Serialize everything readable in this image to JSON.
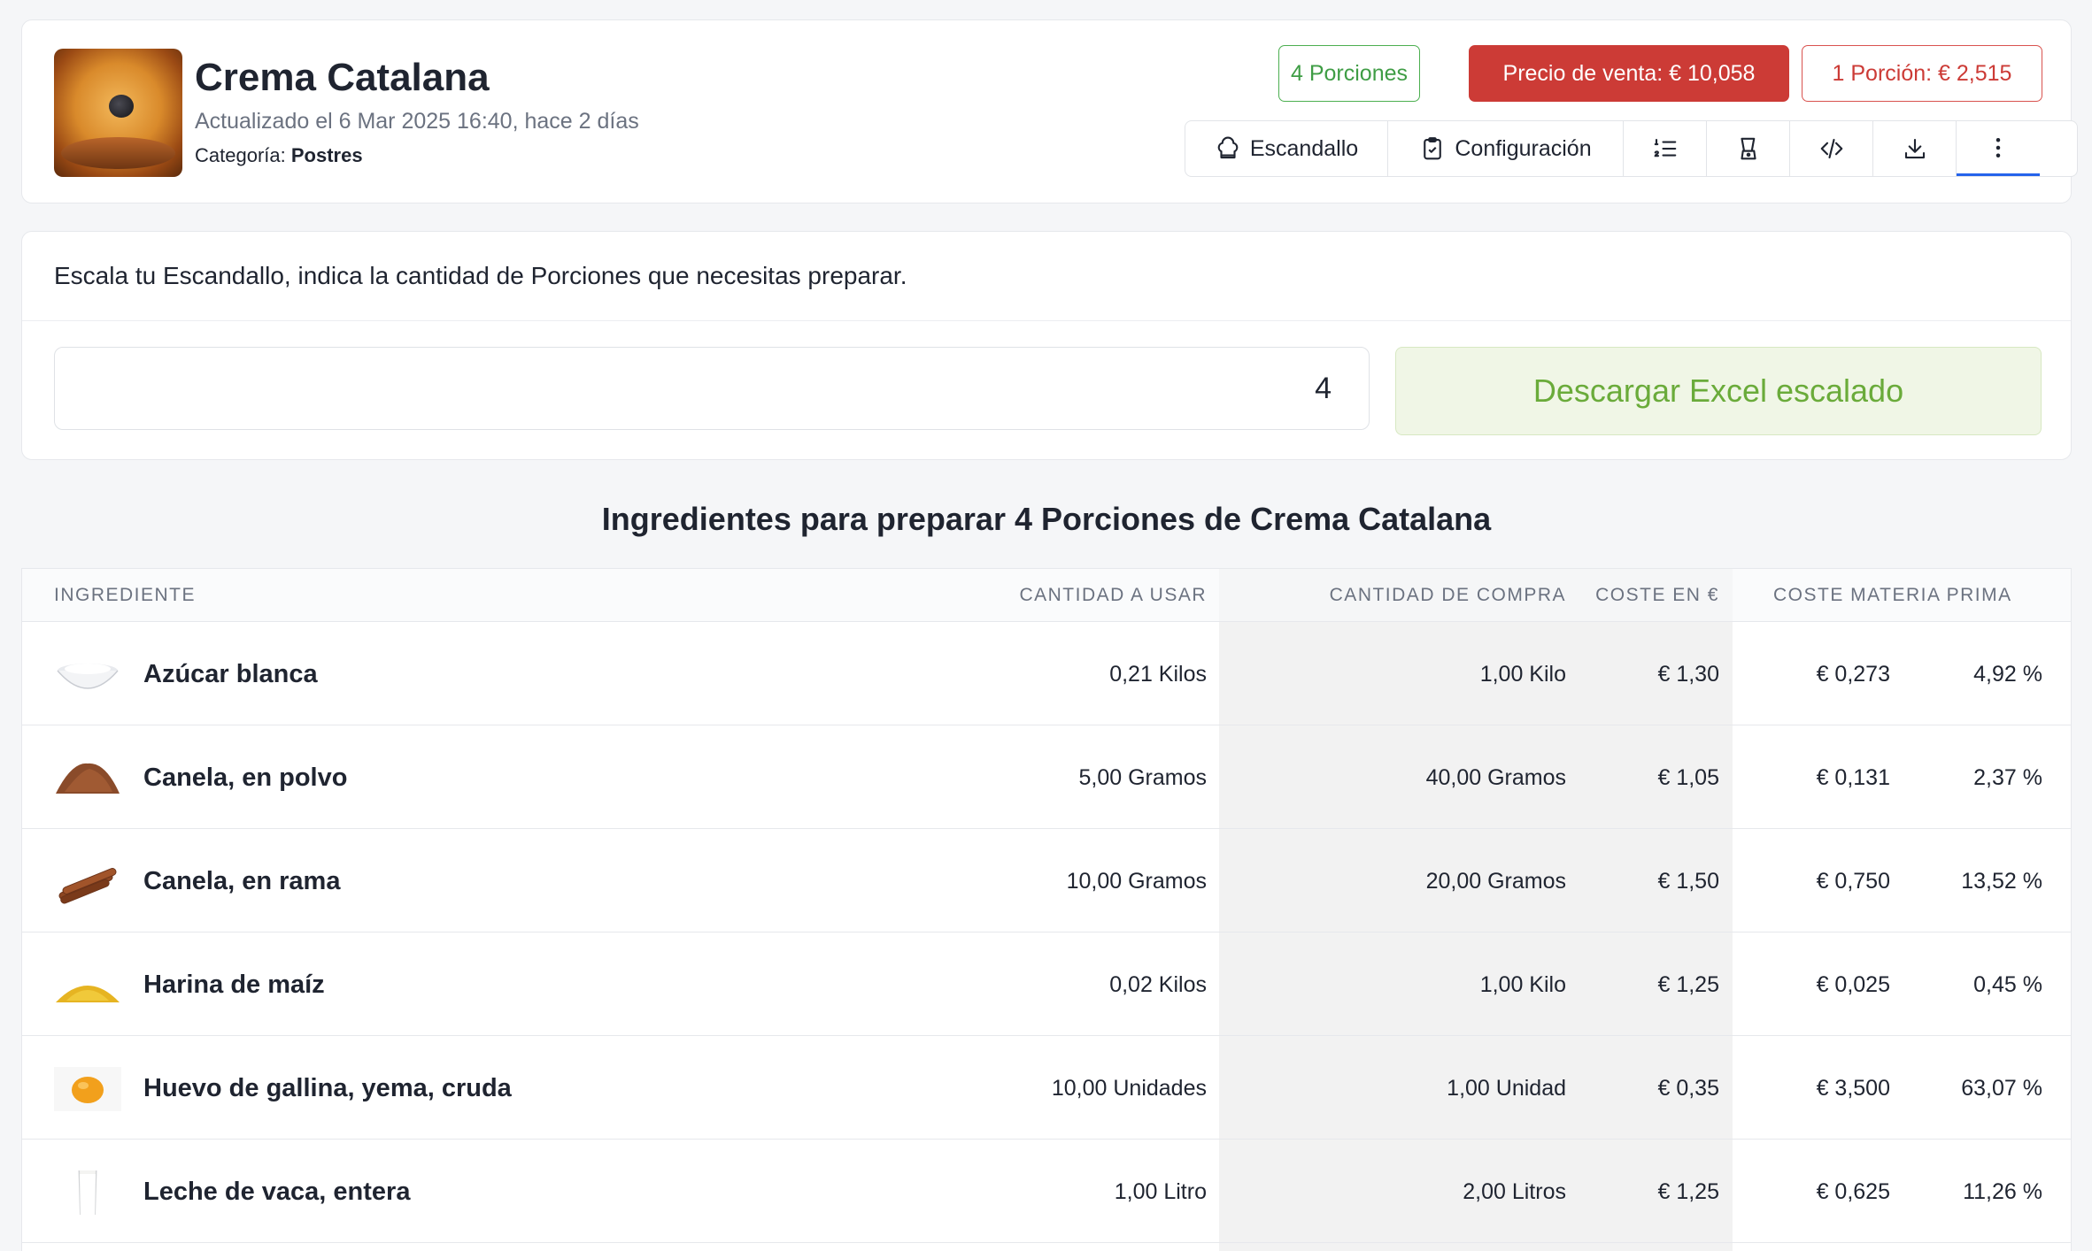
{
  "recipe": {
    "title": "Crema Catalana",
    "updated": "Actualizado el 6 Mar 2025 16:40, hace 2 días",
    "category_label": "Categoría:",
    "category_value": "Postres"
  },
  "badges": {
    "portions": "4 Porciones",
    "sale_price": "Precio de venta: € 10,058",
    "portion_cost": "1 Porción: € 2,515"
  },
  "toolbar": {
    "escandallo": "Escandallo",
    "configuracion": "Configuración"
  },
  "scale": {
    "description": "Escala tu Escandallo, indica la cantidad de Porciones que necesitas preparar.",
    "portions_value": "4",
    "download_button": "Descargar Excel escalado"
  },
  "table": {
    "title": "Ingredientes para preparar 4 Porciones de Crema Catalana",
    "headers": {
      "ingredient": "Ingrediente",
      "quantity_use": "Cantidad a usar",
      "quantity_buy": "Cantidad de compra",
      "cost": "Coste en €",
      "raw_cost": "Coste materia prima"
    },
    "rows": [
      {
        "icon": "sugar-bowl-icon",
        "name": "Azúcar blanca",
        "use": "0,21 Kilos",
        "buy": "1,00 Kilo",
        "cost": "€ 1,30",
        "raw": "€ 0,273",
        "pct": "4,92 %"
      },
      {
        "icon": "cinnamon-powder-icon",
        "name": "Canela, en polvo",
        "use": "5,00 Gramos",
        "buy": "40,00 Gramos",
        "cost": "€ 1,05",
        "raw": "€ 0,131",
        "pct": "2,37 %"
      },
      {
        "icon": "cinnamon-stick-icon",
        "name": "Canela, en rama",
        "use": "10,00 Gramos",
        "buy": "20,00 Gramos",
        "cost": "€ 1,50",
        "raw": "€ 0,750",
        "pct": "13,52 %"
      },
      {
        "icon": "corn-flour-icon",
        "name": "Harina de maíz",
        "use": "0,02 Kilos",
        "buy": "1,00 Kilo",
        "cost": "€ 1,25",
        "raw": "€ 0,025",
        "pct": "0,45 %"
      },
      {
        "icon": "egg-yolk-icon",
        "name": "Huevo de gallina, yema, cruda",
        "use": "10,00 Unidades",
        "buy": "1,00 Unidad",
        "cost": "€ 0,35",
        "raw": "€ 3,500",
        "pct": "63,07 %"
      },
      {
        "icon": "milk-glass-icon",
        "name": "Leche de vaca, entera",
        "use": "1,00 Litro",
        "buy": "2,00 Litros",
        "cost": "€ 1,25",
        "raw": "€ 0,625",
        "pct": "11,26 %"
      }
    ]
  }
}
